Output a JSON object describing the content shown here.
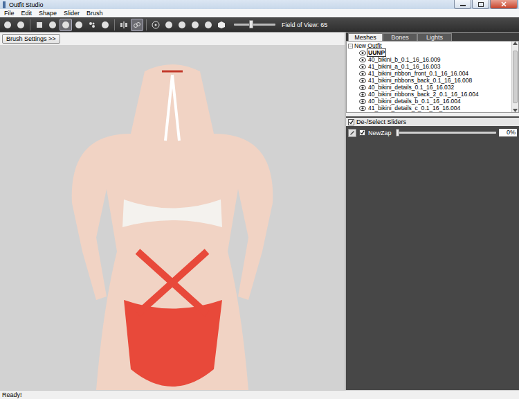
{
  "window": {
    "title": "Outfit Studio"
  },
  "menu": [
    "File",
    "Edit",
    "Shape",
    "Slider",
    "Brush"
  ],
  "toolbar": {
    "tools": [
      {
        "selected": false
      },
      {
        "selected": false
      },
      {
        "selected": false
      },
      {
        "selected": false
      },
      {
        "selected": true
      },
      {
        "selected": false
      },
      {
        "selected": false
      },
      {
        "selected": false
      },
      {
        "selected": false
      },
      {
        "selected": true
      },
      {
        "selected": false
      },
      {
        "selected": false
      },
      {
        "selected": false
      },
      {
        "selected": false
      },
      {
        "selected": false
      },
      {
        "selected": false
      }
    ],
    "fov_label": "Field of View: 65",
    "fov_level": 0.42
  },
  "brush_settings": "Brush Settings >>",
  "tabs": [
    {
      "label": "Meshes",
      "selected": true
    },
    {
      "label": "Bones",
      "selected": false
    },
    {
      "label": "Lights",
      "selected": false
    }
  ],
  "tree": {
    "root": "New Outfit",
    "expanded": true,
    "items": [
      {
        "label": "UUNP",
        "visible": true,
        "selected": true
      },
      {
        "label": "40_bikini_b_0.1_16_16.009",
        "visible": true,
        "selected": false
      },
      {
        "label": "41_bikini_a_0.1_16_16.003",
        "visible": true,
        "selected": false
      },
      {
        "label": "41_bikini_ribbon_front_0.1_16_16.004",
        "visible": true,
        "selected": false
      },
      {
        "label": "41_bikini_ribbons_back_0.1_16_16.008",
        "visible": true,
        "selected": false
      },
      {
        "label": "40_bikini_details_0.1_16_16.032",
        "visible": true,
        "selected": false
      },
      {
        "label": "40_bikini_ribbons_back_2_0.1_16_16.004",
        "visible": true,
        "selected": false
      },
      {
        "label": "40_bikini_details_b_0.1_16_16.004",
        "visible": true,
        "selected": false
      },
      {
        "label": "41_bikini_details_c_0.1_16_16.004",
        "visible": true,
        "selected": false
      }
    ]
  },
  "sliders_header": {
    "label": "De-/Select Sliders",
    "checked": true
  },
  "sliders": [
    {
      "name": "NewZap",
      "checked": true,
      "level": 0,
      "reading": "0%"
    }
  ],
  "status_bar": "Ready!"
}
